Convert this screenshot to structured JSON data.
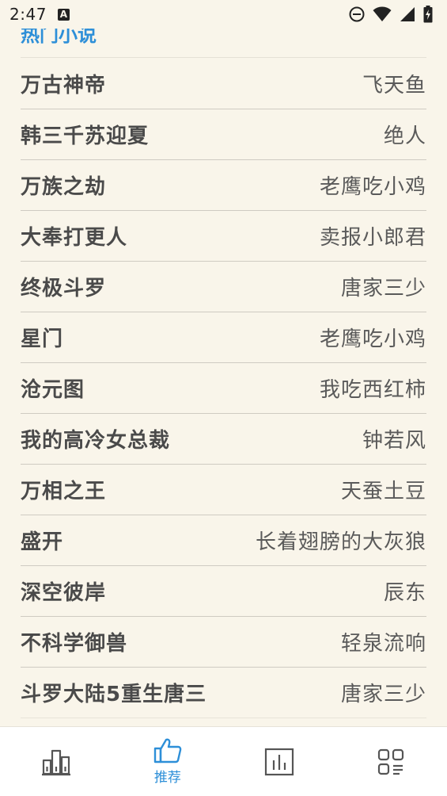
{
  "status_bar": {
    "time": "2:47",
    "notification_glyph": "A"
  },
  "section": {
    "title": "热门小说"
  },
  "books": [
    {
      "title": "万古神帝",
      "author": "飞天鱼"
    },
    {
      "title": "韩三千苏迎夏",
      "author": "绝人"
    },
    {
      "title": "万族之劫",
      "author": "老鹰吃小鸡"
    },
    {
      "title": "大奉打更人",
      "author": "卖报小郎君"
    },
    {
      "title": "终极斗罗",
      "author": "唐家三少"
    },
    {
      "title": "星门",
      "author": "老鹰吃小鸡"
    },
    {
      "title": "沧元图",
      "author": "我吃西红柿"
    },
    {
      "title": "我的高冷女总裁",
      "author": "钟若风"
    },
    {
      "title": "万相之王",
      "author": "天蚕土豆"
    },
    {
      "title": "盛开",
      "author": "长着翅膀的大灰狼"
    },
    {
      "title": "深空彼岸",
      "author": "辰东"
    },
    {
      "title": "不科学御兽",
      "author": "轻泉流响"
    },
    {
      "title": "斗罗大陆5重生唐三",
      "author": "唐家三少"
    }
  ],
  "bottom_nav": {
    "items": [
      {
        "icon": "bookshelf-icon",
        "label": ""
      },
      {
        "icon": "thumbs-up-icon",
        "label": "推荐",
        "active": true
      },
      {
        "icon": "ranking-chart-icon",
        "label": ""
      },
      {
        "icon": "category-grid-icon",
        "label": ""
      }
    ]
  },
  "colors": {
    "background": "#f9f5ea",
    "accent": "#2d8fd8",
    "text": "#4a4a4a"
  }
}
